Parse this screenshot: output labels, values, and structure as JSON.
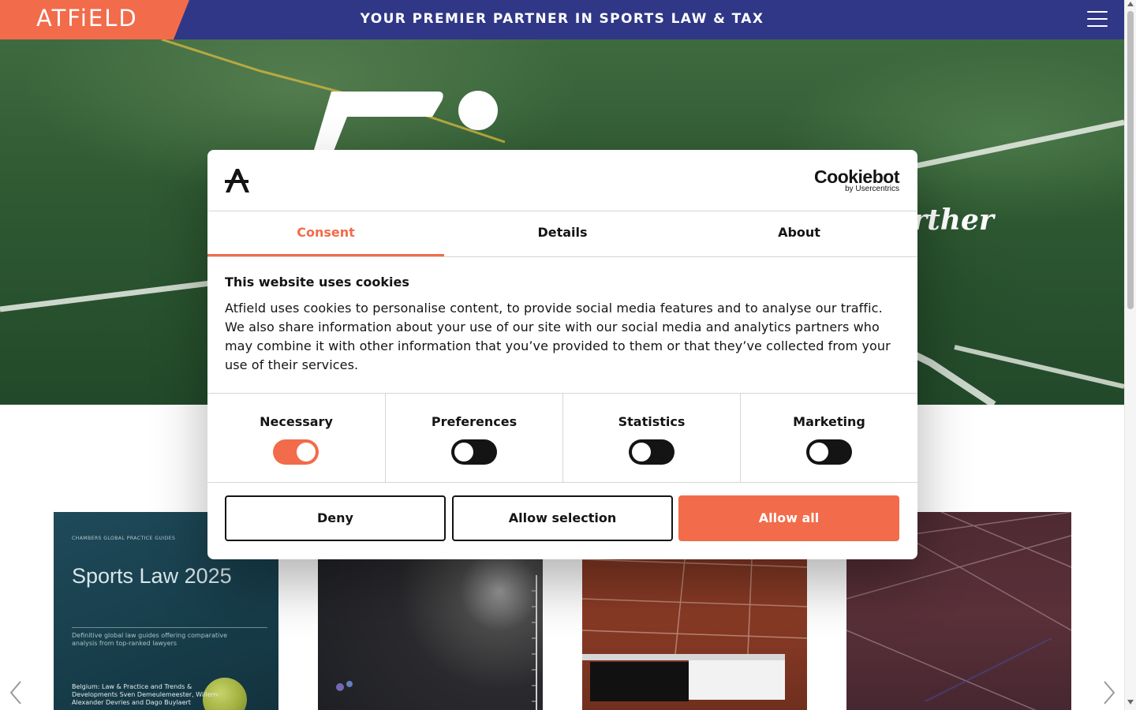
{
  "header": {
    "logo": "ATFiELD",
    "tagline": "YOUR PREMIER PARTNER IN SPORTS LAW & TAX",
    "menu_icon": "hamburger-menu-icon"
  },
  "hero": {
    "tagline_fragment": "urther"
  },
  "carousel": {
    "cards": [
      {
        "cover_small": "CHAMBERS GLOBAL PRACTICE GUIDES",
        "cover_title": "Sports Law 2025",
        "cover_desc": "Definitive global law guides offering comparative analysis from top-ranked lawyers",
        "cover_sub": "Belgium: Law & Practice and Trends & Developments Sven Demeulemeester, Willem-Alexander Devries and Dago Buylaert"
      },
      {},
      {},
      {}
    ],
    "prev_icon": "chevron-left-icon",
    "next_icon": "chevron-right-icon"
  },
  "cookie_dialog": {
    "brand_name": "Cookiebot",
    "brand_by": "by Usercentrics",
    "tabs": [
      "Consent",
      "Details",
      "About"
    ],
    "active_tab": "Consent",
    "title": "This website uses cookies",
    "text": "Atfield uses cookies to personalise content, to provide social media features and to analyse our traffic. We also share information about your use of our site with our social media and analytics partners who may combine it with other information that you’ve provided to them or that they’ve collected from your use of their services.",
    "toggles": [
      {
        "label": "Necessary",
        "on": true
      },
      {
        "label": "Preferences",
        "on": false
      },
      {
        "label": "Statistics",
        "on": false
      },
      {
        "label": "Marketing",
        "on": false
      }
    ],
    "buttons": {
      "deny": "Deny",
      "allow_selection": "Allow selection",
      "allow_all": "Allow all"
    }
  },
  "colors": {
    "brand_orange": "#f26b4a",
    "brand_navy": "#2f3786",
    "text_dark": "#141414",
    "field_green": "#2f5a32"
  }
}
